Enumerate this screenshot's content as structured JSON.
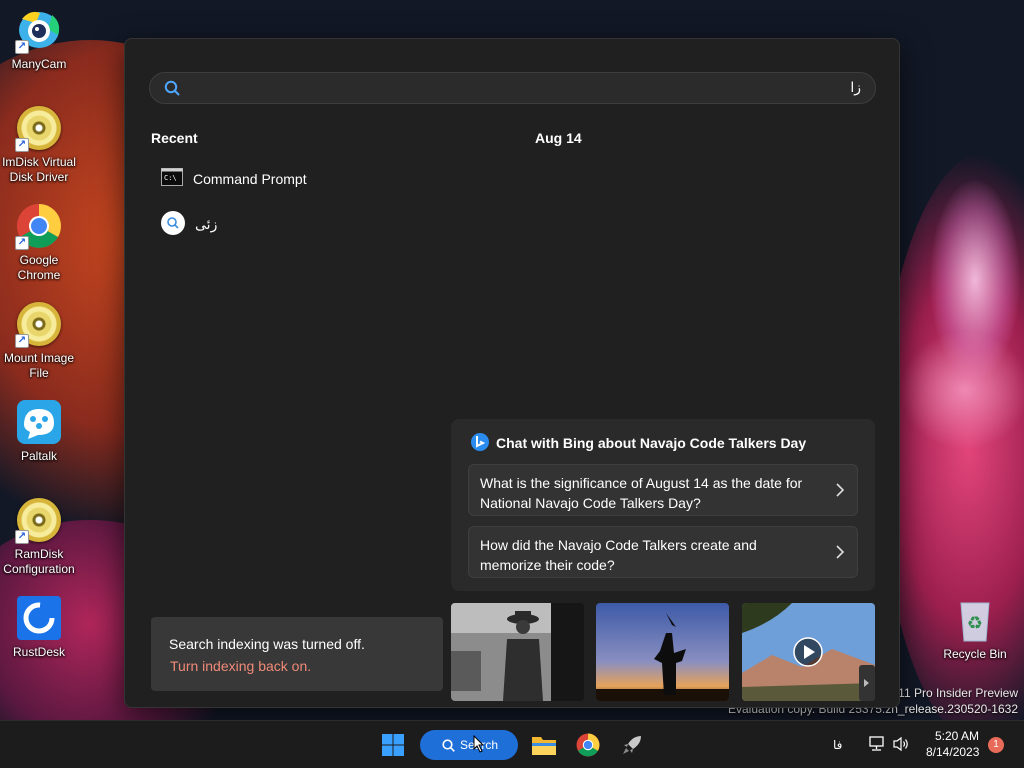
{
  "desktop": {
    "icons": [
      {
        "label": "ManyCam"
      },
      {
        "label": "ImDisk Virtual Disk Driver"
      },
      {
        "label": "Google Chrome"
      },
      {
        "label": "Mount Image File"
      },
      {
        "label": "Paltalk"
      },
      {
        "label": "RamDisk Configuration"
      },
      {
        "label": "RustDesk"
      }
    ],
    "recycle_bin": {
      "label": "Recycle Bin"
    }
  },
  "search_panel": {
    "query": "زا",
    "recent_title": "Recent",
    "recent_items": [
      {
        "label": "Command Prompt",
        "icon": "command-prompt-icon"
      },
      {
        "label": "زئی",
        "icon": "search-icon"
      }
    ],
    "date_heading": "Aug 14",
    "bing": {
      "title": "Chat with Bing about Navajo Code Talkers Day",
      "questions": [
        "What is the significance of August 14 as the date for National Navajo Code Talkers Day?",
        "How did the Navajo Code Talkers create and memorize their code?"
      ]
    },
    "indexing_notice": {
      "message": "Search indexing was turned off.",
      "link": "Turn indexing back on."
    }
  },
  "watermark": {
    "line1": "s 11 Pro Insider Preview",
    "line2": "Evaluation copy. Build 25375.zn_release.230520-1632"
  },
  "taskbar": {
    "search_label": "Search",
    "language": "فا",
    "time": "5:20 AM",
    "date": "8/14/2023",
    "notification_count": "1"
  },
  "colors": {
    "accent": "#1f6fd8",
    "link": "#f08a78",
    "panel": "#202020",
    "card": "#2a2a2a"
  }
}
